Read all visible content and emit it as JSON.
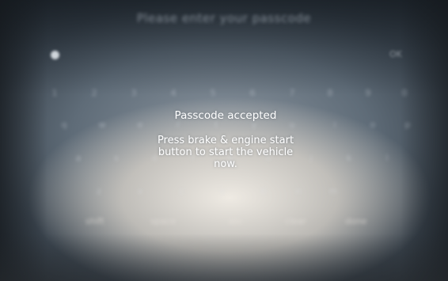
{
  "screen": {
    "prompt": "Please enter your passcode",
    "corner_key": "OK"
  },
  "keyboard": {
    "row1": [
      "1",
      "2",
      "3",
      "4",
      "5",
      "6",
      "7",
      "8",
      "9",
      "0"
    ],
    "row2": [
      "q",
      "w",
      "e",
      "r",
      "t",
      "y",
      "u",
      "i",
      "o",
      "p"
    ],
    "row3": [
      "a",
      "s",
      "d",
      "f",
      "g",
      "h",
      "j",
      "k",
      "l"
    ],
    "row4": [
      "z",
      "x",
      "c",
      "v",
      "b",
      "n",
      "m"
    ],
    "function_keys": [
      "shift",
      "space",
      "abc",
      "clear",
      "done"
    ]
  },
  "message": {
    "title": "Passcode accepted",
    "body": "Press brake & engine start button to start the vehicle now."
  },
  "icons": {
    "corner_dot": "status-dot-icon"
  }
}
